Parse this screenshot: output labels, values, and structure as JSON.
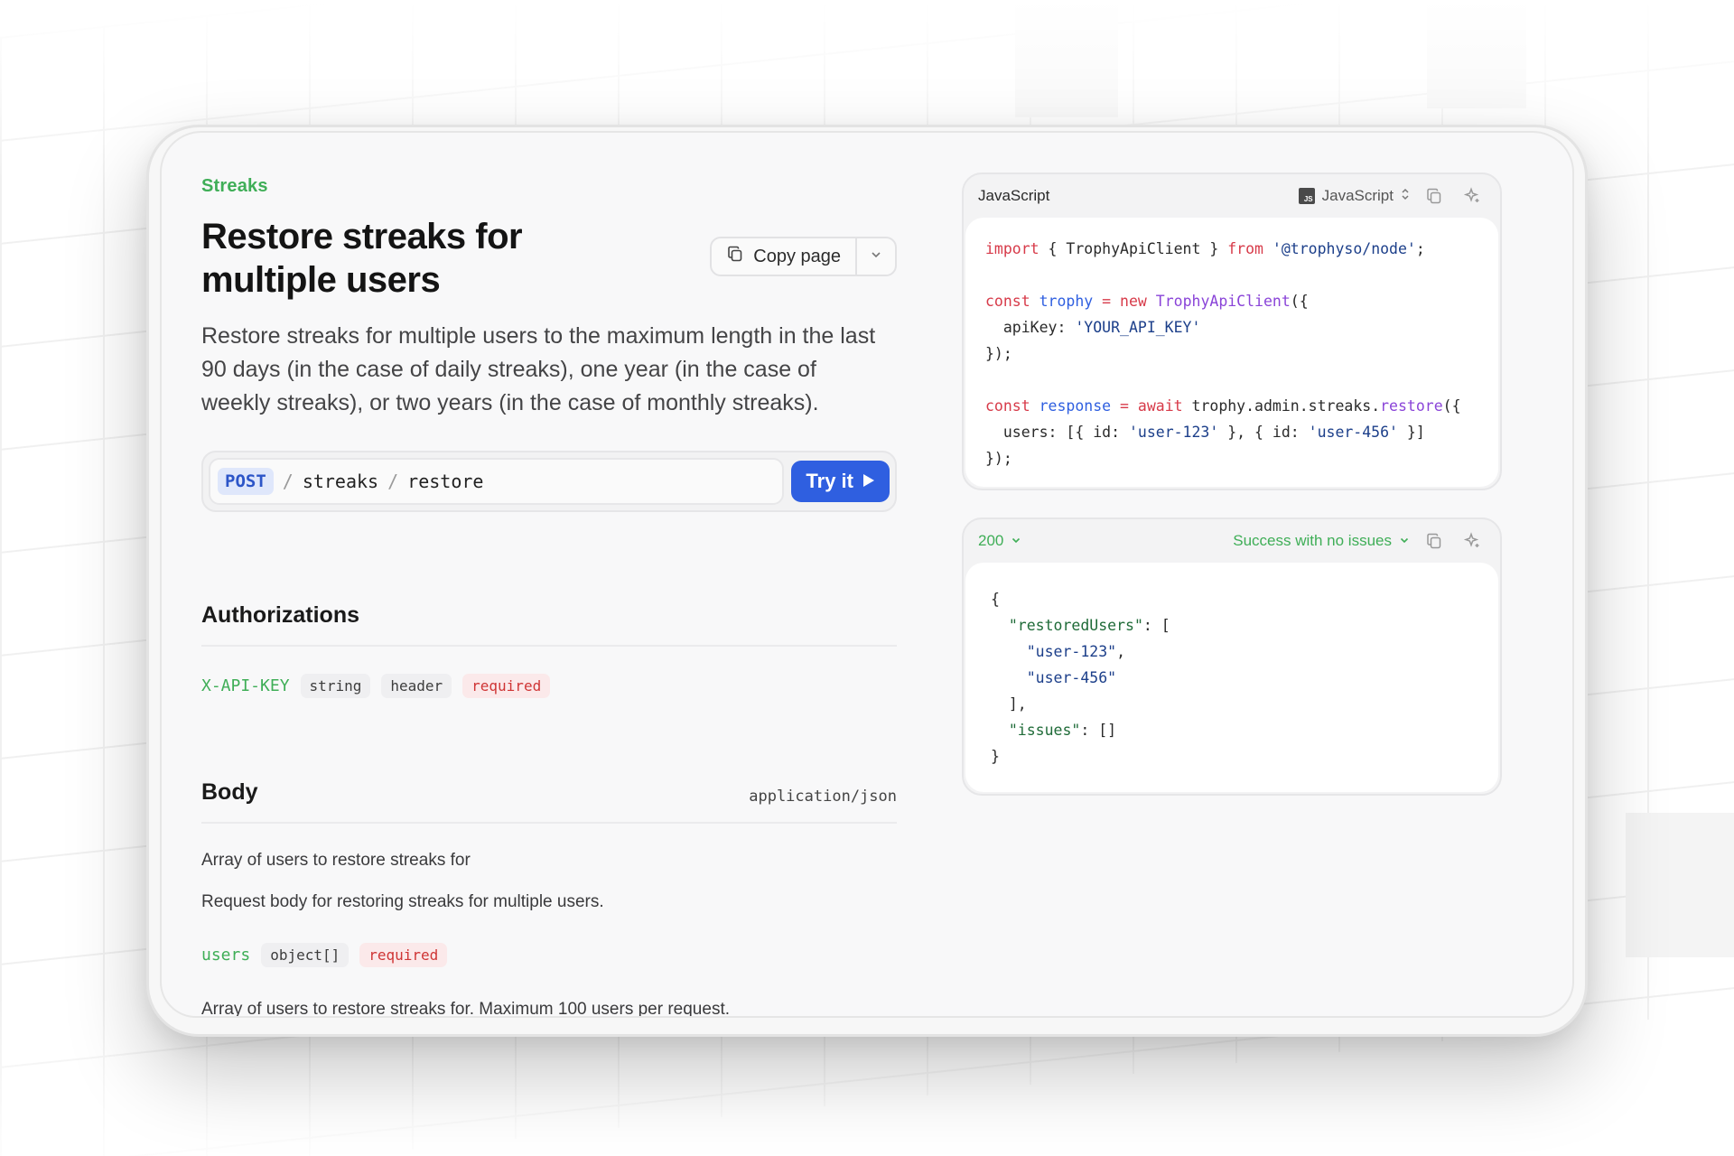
{
  "page": {
    "eyebrow": "Streaks",
    "title": "Restore streaks for multiple users",
    "description": "Restore streaks for multiple users to the maximum length in the last 90 days (in the case of daily streaks), one year (in the case of weekly streaks), or two years (in the case of monthly streaks).",
    "copy_page_label": "Copy page"
  },
  "endpoint": {
    "method": "POST",
    "path_segments": [
      "streaks",
      "restore"
    ],
    "try_label": "Try it"
  },
  "authorizations": {
    "title": "Authorizations",
    "field": {
      "name": "X-API-KEY",
      "type": "string",
      "location": "header",
      "required": "required"
    }
  },
  "body": {
    "title": "Body",
    "content_type": "application/json",
    "desc1": "Array of users to restore streaks for",
    "desc2": "Request body for restoring streaks for multiple users.",
    "field": {
      "name": "users",
      "type": "object[]",
      "required": "required"
    },
    "field_desc": "Array of users to restore streaks for. Maximum 100 users per request."
  },
  "request_panel": {
    "title": "JavaScript",
    "language": "JavaScript",
    "language_badge": "JS"
  },
  "response_panel": {
    "status": "200",
    "status_text": "Success with no issues"
  },
  "icons": {
    "copy": "copy-icon",
    "sparkle": "sparkle-icon",
    "chevron": "chevron-down-icon",
    "play": "play-icon",
    "updown": "chevron-updown-icon"
  },
  "colors": {
    "accent_green": "#3fae57",
    "primary_blue": "#2f5fe0",
    "required_red": "#cf3535"
  }
}
